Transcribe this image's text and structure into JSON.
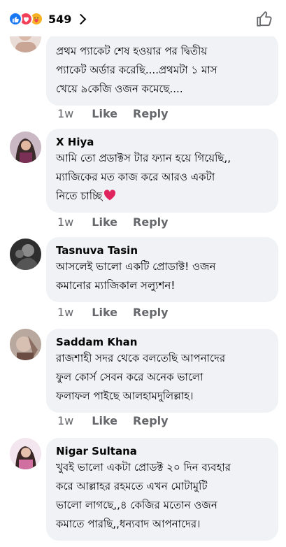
{
  "header": {
    "reaction_count": "549",
    "reactions": [
      "like-icon",
      "love-icon",
      "care-icon"
    ],
    "colors": {
      "like": "#1877f2",
      "love": "#f33e58",
      "care": "#f7b125"
    }
  },
  "actions_labels": {
    "like": "Like",
    "reply": "Reply"
  },
  "comments": [
    {
      "author": "",
      "text": "প্রথম প্যাকেট শেষ হওয়ার পর দ্বিতীয়\nপ্যাকেট অর্ডার করেছি....প্রথমটা ১ মাস\nখেয়ে ৯কেজি ওজন কমেছে....",
      "time": "1w"
    },
    {
      "author": "X Hiya",
      "text": "আমি তো প্রডাক্টস টার ফ্যান হয়ে গিয়েছি,,\nম্যাজিকের মত কাজ করে   আরও একটা\nনিতে চাচ্ছি",
      "time": "1w"
    },
    {
      "author": "Tasnuva Tasin",
      "text": "আসলেই ভালো একটি প্রোডাক্ট! ওজন\nকমানোর ম্যাজিকাল সল্যুশন!",
      "time": "1w"
    },
    {
      "author": "Saddam Khan",
      "text": "রাজশাহী সদর থেকে বলতেছি আপনাদের\nফুল কোর্স সেবন করে অনেক ভালো\nফলাফল পাইছে আলহামদুলিল্লাহ।",
      "time": "1w"
    },
    {
      "author": "Nigar Sultana",
      "text": "খুবই ভালো একটা প্রোডক্ট ২০ দিন ব্যবহার\nকরে আল্লাহর রহমতে এখন মোটামুটি\nভালো লাগছে,,৪ কেজির মতোন ওজন\nকমাতে পারছি,,ধন্যবাদ আপনাদের।",
      "time": ""
    }
  ]
}
